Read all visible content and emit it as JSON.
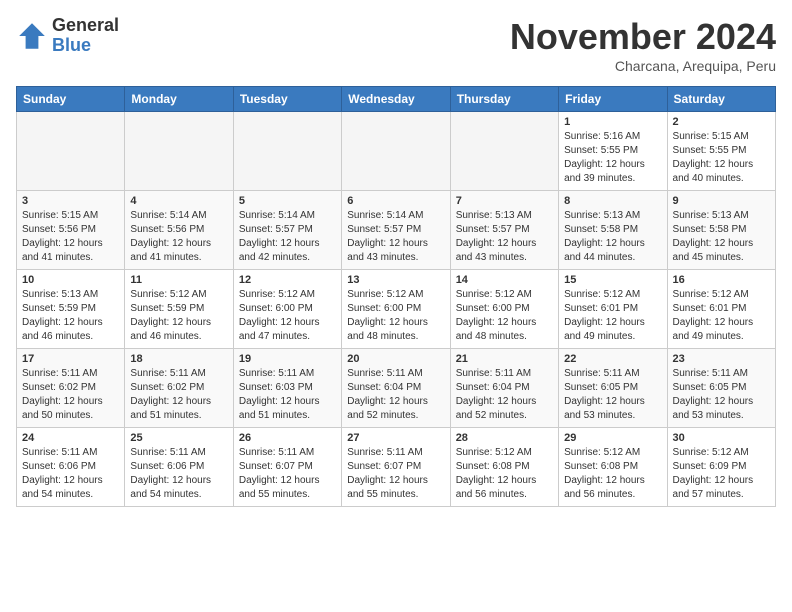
{
  "header": {
    "logo_general": "General",
    "logo_blue": "Blue",
    "month": "November 2024",
    "location": "Charcana, Arequipa, Peru"
  },
  "weekdays": [
    "Sunday",
    "Monday",
    "Tuesday",
    "Wednesday",
    "Thursday",
    "Friday",
    "Saturday"
  ],
  "weeks": [
    [
      {
        "day": "",
        "empty": true
      },
      {
        "day": "",
        "empty": true
      },
      {
        "day": "",
        "empty": true
      },
      {
        "day": "",
        "empty": true
      },
      {
        "day": "",
        "empty": true
      },
      {
        "day": "1",
        "sunrise": "5:16 AM",
        "sunset": "5:55 PM",
        "daylight": "12 hours and 39 minutes."
      },
      {
        "day": "2",
        "sunrise": "5:15 AM",
        "sunset": "5:55 PM",
        "daylight": "12 hours and 40 minutes."
      }
    ],
    [
      {
        "day": "3",
        "sunrise": "5:15 AM",
        "sunset": "5:56 PM",
        "daylight": "12 hours and 41 minutes."
      },
      {
        "day": "4",
        "sunrise": "5:14 AM",
        "sunset": "5:56 PM",
        "daylight": "12 hours and 41 minutes."
      },
      {
        "day": "5",
        "sunrise": "5:14 AM",
        "sunset": "5:57 PM",
        "daylight": "12 hours and 42 minutes."
      },
      {
        "day": "6",
        "sunrise": "5:14 AM",
        "sunset": "5:57 PM",
        "daylight": "12 hours and 43 minutes."
      },
      {
        "day": "7",
        "sunrise": "5:13 AM",
        "sunset": "5:57 PM",
        "daylight": "12 hours and 43 minutes."
      },
      {
        "day": "8",
        "sunrise": "5:13 AM",
        "sunset": "5:58 PM",
        "daylight": "12 hours and 44 minutes."
      },
      {
        "day": "9",
        "sunrise": "5:13 AM",
        "sunset": "5:58 PM",
        "daylight": "12 hours and 45 minutes."
      }
    ],
    [
      {
        "day": "10",
        "sunrise": "5:13 AM",
        "sunset": "5:59 PM",
        "daylight": "12 hours and 46 minutes."
      },
      {
        "day": "11",
        "sunrise": "5:12 AM",
        "sunset": "5:59 PM",
        "daylight": "12 hours and 46 minutes."
      },
      {
        "day": "12",
        "sunrise": "5:12 AM",
        "sunset": "6:00 PM",
        "daylight": "12 hours and 47 minutes."
      },
      {
        "day": "13",
        "sunrise": "5:12 AM",
        "sunset": "6:00 PM",
        "daylight": "12 hours and 48 minutes."
      },
      {
        "day": "14",
        "sunrise": "5:12 AM",
        "sunset": "6:00 PM",
        "daylight": "12 hours and 48 minutes."
      },
      {
        "day": "15",
        "sunrise": "5:12 AM",
        "sunset": "6:01 PM",
        "daylight": "12 hours and 49 minutes."
      },
      {
        "day": "16",
        "sunrise": "5:12 AM",
        "sunset": "6:01 PM",
        "daylight": "12 hours and 49 minutes."
      }
    ],
    [
      {
        "day": "17",
        "sunrise": "5:11 AM",
        "sunset": "6:02 PM",
        "daylight": "12 hours and 50 minutes."
      },
      {
        "day": "18",
        "sunrise": "5:11 AM",
        "sunset": "6:02 PM",
        "daylight": "12 hours and 51 minutes."
      },
      {
        "day": "19",
        "sunrise": "5:11 AM",
        "sunset": "6:03 PM",
        "daylight": "12 hours and 51 minutes."
      },
      {
        "day": "20",
        "sunrise": "5:11 AM",
        "sunset": "6:04 PM",
        "daylight": "12 hours and 52 minutes."
      },
      {
        "day": "21",
        "sunrise": "5:11 AM",
        "sunset": "6:04 PM",
        "daylight": "12 hours and 52 minutes."
      },
      {
        "day": "22",
        "sunrise": "5:11 AM",
        "sunset": "6:05 PM",
        "daylight": "12 hours and 53 minutes."
      },
      {
        "day": "23",
        "sunrise": "5:11 AM",
        "sunset": "6:05 PM",
        "daylight": "12 hours and 53 minutes."
      }
    ],
    [
      {
        "day": "24",
        "sunrise": "5:11 AM",
        "sunset": "6:06 PM",
        "daylight": "12 hours and 54 minutes."
      },
      {
        "day": "25",
        "sunrise": "5:11 AM",
        "sunset": "6:06 PM",
        "daylight": "12 hours and 54 minutes."
      },
      {
        "day": "26",
        "sunrise": "5:11 AM",
        "sunset": "6:07 PM",
        "daylight": "12 hours and 55 minutes."
      },
      {
        "day": "27",
        "sunrise": "5:11 AM",
        "sunset": "6:07 PM",
        "daylight": "12 hours and 55 minutes."
      },
      {
        "day": "28",
        "sunrise": "5:12 AM",
        "sunset": "6:08 PM",
        "daylight": "12 hours and 56 minutes."
      },
      {
        "day": "29",
        "sunrise": "5:12 AM",
        "sunset": "6:08 PM",
        "daylight": "12 hours and 56 minutes."
      },
      {
        "day": "30",
        "sunrise": "5:12 AM",
        "sunset": "6:09 PM",
        "daylight": "12 hours and 57 minutes."
      }
    ]
  ]
}
